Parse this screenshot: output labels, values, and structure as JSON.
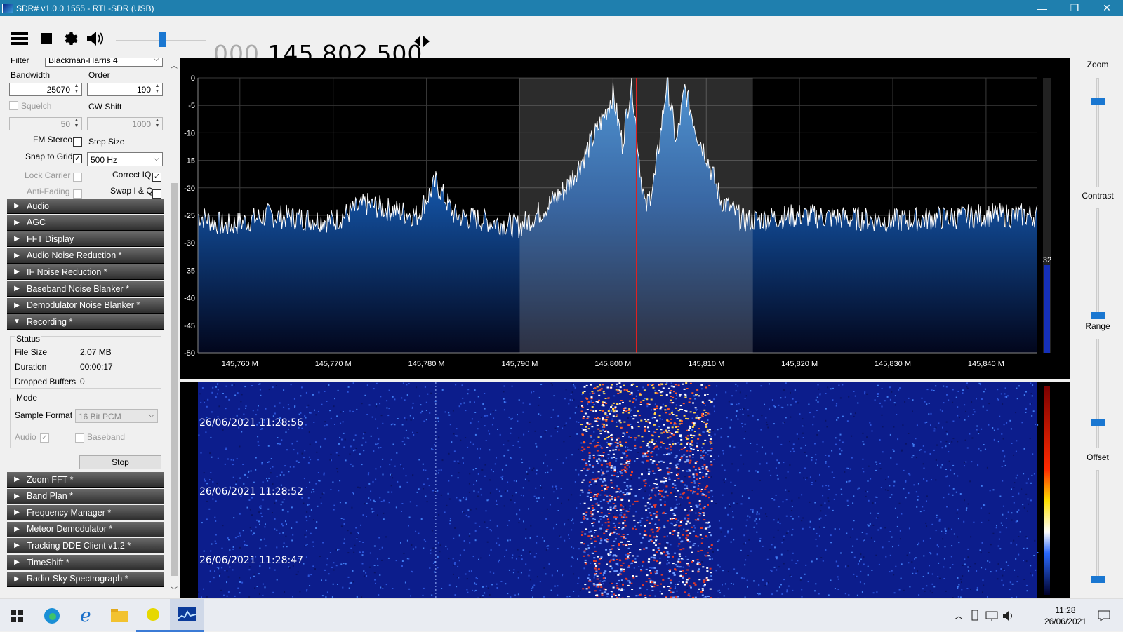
{
  "window": {
    "title": "SDR# v1.0.0.1555 - RTL-SDR (USB)",
    "minimize": "—",
    "maximize": "❐",
    "close": "✕"
  },
  "toolbar": {
    "freq_prefix": "000.",
    "freq_main": "145.802.500",
    "volume_level": 0.55
  },
  "left": {
    "filter_label": "Filter",
    "filter_value": "Blackman-Harris 4",
    "bandwidth_label": "Bandwidth",
    "bandwidth_value": "25070",
    "order_label": "Order",
    "order_value": "190",
    "squelch_label": "Squelch",
    "squelch_value": "50",
    "cwshift_label": "CW Shift",
    "cwshift_value": "1000",
    "fmstereo_label": "FM Stereo",
    "stepsize_label": "Step Size",
    "snap_label": "Snap to Grid",
    "snap_value": "500 Hz",
    "lockcarrier_label": "Lock Carrier",
    "correctiq_label": "Correct IQ",
    "antifading_label": "Anti-Fading",
    "swapiq_label": "Swap I & Q",
    "sections_top": [
      "Audio",
      "AGC",
      "FFT Display",
      "Audio Noise Reduction *",
      "IF Noise Reduction *",
      "Baseband Noise Blanker *",
      "Demodulator Noise Blanker *",
      "Recording *"
    ],
    "recording": {
      "status_label": "Status",
      "filesize_label": "File Size",
      "filesize_value": "2,07 MB",
      "duration_label": "Duration",
      "duration_value": "00:00:17",
      "dropped_label": "Dropped Buffers",
      "dropped_value": "0",
      "mode_label": "Mode",
      "sampleformat_label": "Sample Format",
      "sampleformat_value": "16 Bit PCM",
      "audio_label": "Audio",
      "baseband_label": "Baseband",
      "stop_label": "Stop"
    },
    "sections_bottom": [
      "Zoom FFT *",
      "Band Plan *",
      "Frequency Manager *",
      "Meteor Demodulator *",
      "Tracking DDE Client v1.2 *",
      "TimeShift *",
      "Radio-Sky Spectrograph *"
    ]
  },
  "chart_data": {
    "type": "line",
    "title": "",
    "xlabel": "",
    "ylabel": "",
    "x_ticks": [
      "145,760 M",
      "145,770 M",
      "145,780 M",
      "145,790 M",
      "145,800 M",
      "145,810 M",
      "145,820 M",
      "145,830 M",
      "145,840 M"
    ],
    "x_tick_values_mhz": [
      145.76,
      145.77,
      145.78,
      145.79,
      145.8,
      145.81,
      145.82,
      145.83,
      145.84
    ],
    "xlim": [
      145.7555,
      145.8455
    ],
    "y_ticks": [
      "0",
      "-5",
      "-10",
      "-15",
      "-20",
      "-25",
      "-30",
      "-35",
      "-40",
      "-45",
      "-50"
    ],
    "ylim": [
      -50,
      0
    ],
    "noise_floor_db": -25.5,
    "series": [
      {
        "values_mhz_db": [
          [
            145.7555,
            -25
          ],
          [
            145.7585,
            -27
          ],
          [
            145.763,
            -25
          ],
          [
            145.77,
            -26
          ],
          [
            145.7735,
            -23
          ],
          [
            145.779,
            -25
          ],
          [
            145.781,
            -19
          ],
          [
            145.783,
            -25
          ],
          [
            145.79,
            -27
          ],
          [
            145.7925,
            -24
          ],
          [
            145.795,
            -20
          ],
          [
            145.797,
            -14
          ],
          [
            145.799,
            -7
          ],
          [
            145.8,
            -3
          ],
          [
            145.801,
            -12
          ],
          [
            145.802,
            -0.5
          ],
          [
            145.803,
            -18
          ],
          [
            145.8035,
            -24
          ],
          [
            145.8045,
            -18
          ],
          [
            145.8058,
            -0.5
          ],
          [
            145.8068,
            -12
          ],
          [
            145.8077,
            -2
          ],
          [
            145.809,
            -10
          ],
          [
            145.81,
            -14
          ],
          [
            145.8115,
            -22
          ],
          [
            145.814,
            -26
          ],
          [
            145.82,
            -25
          ],
          [
            145.83,
            -26
          ],
          [
            145.84,
            -25
          ],
          [
            145.8455,
            -25
          ]
        ]
      }
    ],
    "center_marker_mhz": 145.8025,
    "filter_passband_mhz": [
      145.79,
      145.815
    ],
    "level_indicator": "32",
    "waterfall_timestamps": [
      "26/06/2021 11:28:56",
      "26/06/2021 11:28:52",
      "26/06/2021 11:28:47"
    ]
  },
  "right": {
    "zoom_label": "Zoom",
    "contrast_label": "Contrast",
    "range_label": "Range",
    "offset_label": "Offset",
    "zoom_level": 0.22,
    "contrast_level": 0.02,
    "range_level": 0.05,
    "offset_level": 0.0
  },
  "taskbar": {
    "time": "11:28",
    "date": "26/06/2021"
  }
}
